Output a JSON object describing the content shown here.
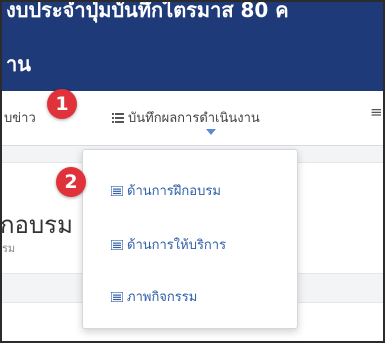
{
  "header": {
    "line1": "งบประจำปุ่มบันทึกไตรมาส 80 ค",
    "line2": "าน"
  },
  "nav": {
    "left_item": "บข่าว",
    "main_item": "บันทึกผลการดำเนินงาน",
    "right_icon": "≡",
    "menu_icon_name": "list-icon"
  },
  "dropdown": {
    "items": [
      {
        "label": "ด้านการฝึกอบรม"
      },
      {
        "label": "ด้านการให้บริการ"
      },
      {
        "label": "ภาพกิจกรรม"
      }
    ]
  },
  "content": {
    "title": "กอบรม",
    "subtitle": "รม"
  },
  "badges": {
    "one": "1",
    "two": "2"
  },
  "colors": {
    "header_bg": "#1f3a78",
    "link": "#2f5fa8",
    "badge": "#e0323a",
    "caret": "#5a8ad6"
  }
}
